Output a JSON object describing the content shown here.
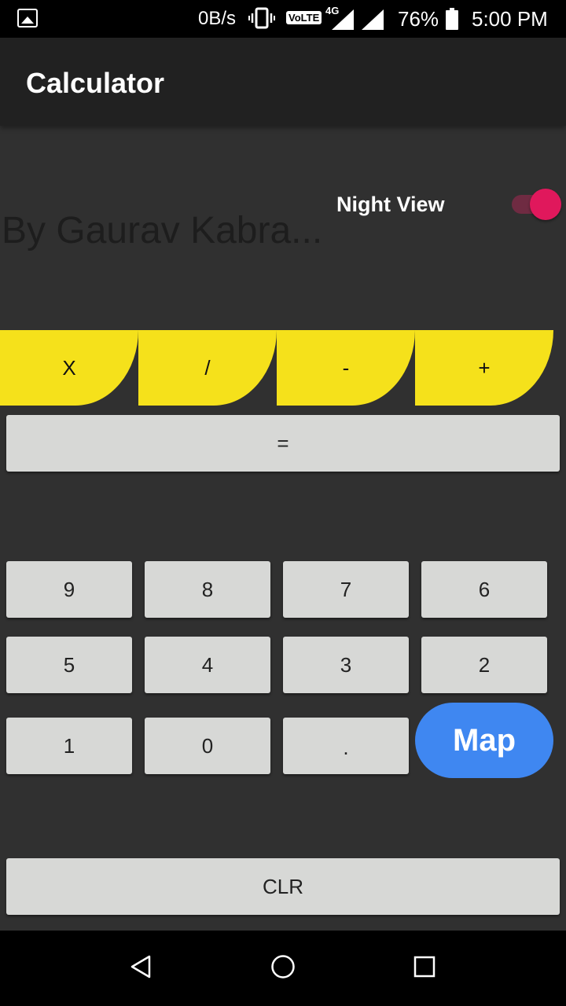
{
  "status_bar": {
    "net_speed": "0B/s",
    "volte": "VoLTE",
    "network_type": "4G",
    "battery": "76%",
    "time": "5:00 PM"
  },
  "app": {
    "title": "Calculator"
  },
  "content": {
    "byline": "By Gaurav Kabra...",
    "night_view_label": "Night View",
    "night_view_on": true
  },
  "operators": [
    "X",
    "/",
    "-",
    "+"
  ],
  "equals_label": "=",
  "keypad": {
    "row1": [
      "9",
      "8",
      "7",
      "6"
    ],
    "row2": [
      "5",
      "4",
      "3",
      "2"
    ],
    "row3": [
      "1",
      "0",
      "."
    ],
    "map_label": "Map"
  },
  "clear_label": "CLR",
  "colors": {
    "background": "#303030",
    "app_bar": "#212121",
    "operator": "#f5e11b",
    "key": "#d7d8d6",
    "map_button": "#3f87f1",
    "switch_accent": "#e0185c"
  },
  "nav": [
    "back-icon",
    "home-icon",
    "recents-icon"
  ]
}
